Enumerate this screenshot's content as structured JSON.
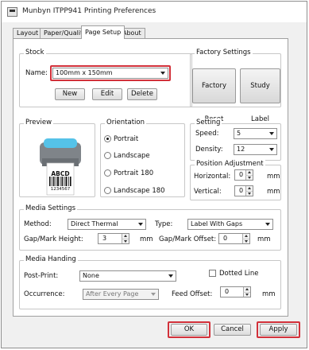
{
  "window": {
    "title": "Munbyn ITPP941 Printing Preferences"
  },
  "tabs": [
    {
      "label": "Layout"
    },
    {
      "label": "Paper/Quality"
    },
    {
      "label": "Page Setup"
    },
    {
      "label": "About"
    }
  ],
  "active_tab": "Page Setup",
  "stock": {
    "group_label": "Stock",
    "name_label": "Name:",
    "name_value": "100mm x 150mm",
    "new_label": "New",
    "edit_label": "Edit",
    "delete_label": "Delete"
  },
  "factory": {
    "group_label": "Factory Settings",
    "reset_label": "Factory Reset",
    "study_label": "Study Label"
  },
  "preview": {
    "group_label": "Preview",
    "label_text": "ABCD",
    "barcode_number": "1234567"
  },
  "orientation": {
    "group_label": "Orientation",
    "options": [
      {
        "label": "Portrait",
        "checked": true
      },
      {
        "label": "Landscape",
        "checked": false
      },
      {
        "label": "Portrait 180",
        "checked": false
      },
      {
        "label": "Landscape 180",
        "checked": false
      }
    ]
  },
  "setting": {
    "group_label": "Setting",
    "speed_label": "Speed:",
    "speed_value": "5",
    "density_label": "Density:",
    "density_value": "12"
  },
  "position": {
    "group_label": "Position Adjustment",
    "horizontal_label": "Horizontal:",
    "horizontal_value": "0",
    "horizontal_unit": "mm",
    "vertical_label": "Vertical:",
    "vertical_value": "0",
    "vertical_unit": "mm"
  },
  "media_settings": {
    "group_label": "Media Settings",
    "method_label": "Method:",
    "method_value": "Direct Thermal",
    "type_label": "Type:",
    "type_value": "Label With Gaps",
    "gap_height_label": "Gap/Mark Height:",
    "gap_height_value": "3",
    "gap_height_unit": "mm",
    "gap_offset_label": "Gap/Mark Offset:",
    "gap_offset_value": "0",
    "gap_offset_unit": "mm"
  },
  "media_handling": {
    "group_label": "Media Handing",
    "post_print_label": "Post-Print:",
    "post_print_value": "None",
    "dotted_line_label": "Dotted Line",
    "occurrence_label": "Occurrence:",
    "occurrence_value": "After Every Page",
    "feed_offset_label": "Feed Offset:",
    "feed_offset_value": "0",
    "feed_offset_unit": "mm"
  },
  "footer": {
    "ok_label": "OK",
    "cancel_label": "Cancel",
    "apply_label": "Apply"
  },
  "colors": {
    "highlight": "#d2313a",
    "printer_body": "#7f8489",
    "printer_lid": "#55c2e8",
    "window_bg": "#f0f0f0"
  }
}
